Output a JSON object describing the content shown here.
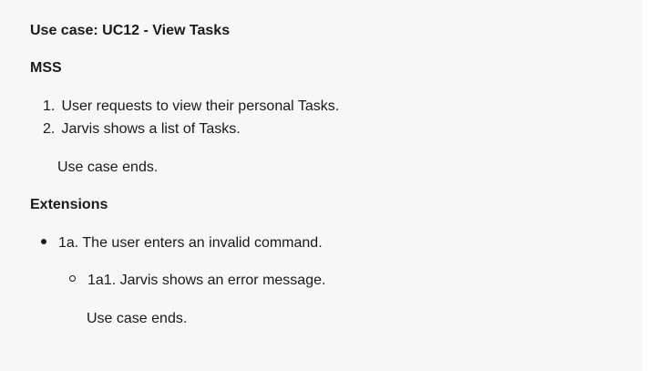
{
  "use_case": {
    "title": "Use case: UC12 - View Tasks"
  },
  "mss": {
    "heading": "MSS",
    "steps": [
      {
        "number": "1.",
        "text": "User requests to view their personal Tasks."
      },
      {
        "number": "2.",
        "text": "Jarvis shows a list of Tasks."
      }
    ],
    "end_note": "Use case ends."
  },
  "extensions": {
    "heading": "Extensions",
    "items": [
      {
        "text": "1a. The user enters an invalid command.",
        "sub_items": [
          {
            "text": "1a1. Jarvis shows an error message."
          }
        ],
        "end_note": "Use case ends."
      }
    ]
  }
}
